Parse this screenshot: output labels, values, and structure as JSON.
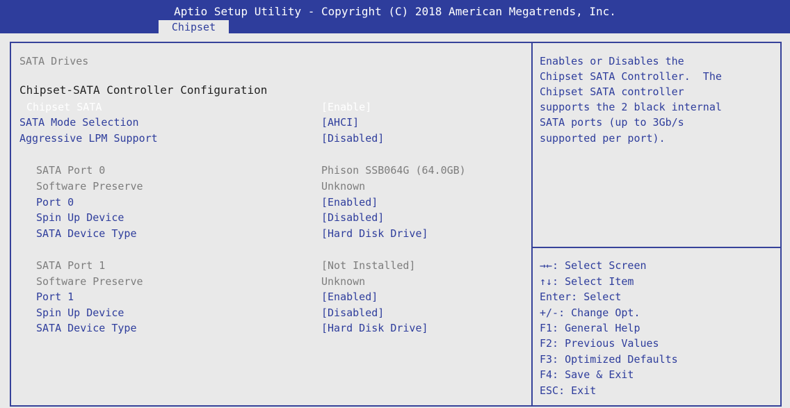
{
  "header": {
    "title": "Aptio Setup Utility - Copyright (C) 2018 American Megatrends, Inc.",
    "active_tab": "Chipset"
  },
  "main": {
    "section_label": "SATA Drives",
    "group_heading": "Chipset-SATA Controller Configuration",
    "settings": [
      {
        "label": "Chipset SATA",
        "value": "[Enable]",
        "selected": true
      },
      {
        "label": "SATA Mode Selection",
        "value": "[AHCI]"
      },
      {
        "label": "Aggressive LPM Support",
        "value": "[Disabled]"
      }
    ],
    "ports": [
      {
        "name": "SATA Port 0",
        "device": "Phison SSB064G (64.0GB)",
        "preserve_label": "Software Preserve",
        "preserve_value": "Unknown",
        "options": [
          {
            "label": "Port 0",
            "value": "[Enabled]"
          },
          {
            "label": "Spin Up Device",
            "value": "[Disabled]"
          },
          {
            "label": "SATA Device Type",
            "value": "[Hard Disk Drive]"
          }
        ]
      },
      {
        "name": "SATA Port 1",
        "device": "[Not Installed]",
        "preserve_label": "Software Preserve",
        "preserve_value": "Unknown",
        "options": [
          {
            "label": "Port 1",
            "value": "[Enabled]"
          },
          {
            "label": "Spin Up Device",
            "value": "[Disabled]"
          },
          {
            "label": "SATA Device Type",
            "value": "[Hard Disk Drive]"
          }
        ]
      }
    ]
  },
  "help": {
    "lines": [
      "Enables or Disables the",
      "Chipset SATA Controller.  The",
      "Chipset SATA controller",
      "supports the 2 black internal",
      "SATA ports (up to 3Gb/s",
      "supported per port)."
    ]
  },
  "keys": {
    "lines": [
      "→←: Select Screen",
      "↑↓: Select Item",
      "Enter: Select",
      "+/-: Change Opt.",
      "F1: General Help",
      "F2: Previous Values",
      "F3: Optimized Defaults",
      "F4: Save & Exit",
      "ESC: Exit"
    ]
  },
  "colors": {
    "title_bar": "#2e3d9c",
    "background": "#e9e9e9",
    "link_text": "#2e3d9c",
    "muted_text": "#7d7d7d",
    "selected_text": "#ffffff"
  }
}
